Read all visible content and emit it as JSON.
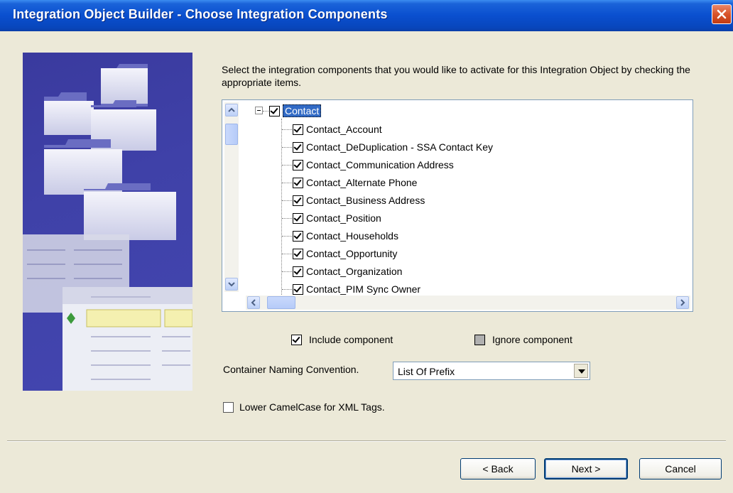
{
  "window": {
    "title": "Integration Object Builder - Choose Integration Components"
  },
  "intro": {
    "text": "Select the integration components that you would like to activate for this Integration Object by checking the appropriate items."
  },
  "tree": {
    "root": {
      "label": "Contact",
      "checked": true,
      "expanded": true
    },
    "children": [
      {
        "label": "Contact_Account",
        "checked": true
      },
      {
        "label": "Contact_DeDuplication - SSA Contact Key",
        "checked": true
      },
      {
        "label": "Contact_Communication Address",
        "checked": true
      },
      {
        "label": "Contact_Alternate Phone",
        "checked": true
      },
      {
        "label": "Contact_Business Address",
        "checked": true
      },
      {
        "label": "Contact_Position",
        "checked": true
      },
      {
        "label": "Contact_Households",
        "checked": true
      },
      {
        "label": "Contact_Opportunity",
        "checked": true
      },
      {
        "label": "Contact_Organization",
        "checked": true
      },
      {
        "label": "Contact_PIM Sync Owner",
        "checked": true
      }
    ]
  },
  "legend": {
    "include_label": "Include component",
    "ignore_label": "Ignore component"
  },
  "naming": {
    "label": "Container Naming Convention.",
    "value": "List Of Prefix"
  },
  "camelcase": {
    "label": "Lower CamelCase for XML Tags.",
    "checked": false
  },
  "buttons": {
    "back": "< Back",
    "next": "Next >",
    "cancel": "Cancel"
  },
  "colors": {
    "titlebar": "#0a4fcf",
    "selection": "#316ac5",
    "dialog_bg": "#ece9d8"
  }
}
